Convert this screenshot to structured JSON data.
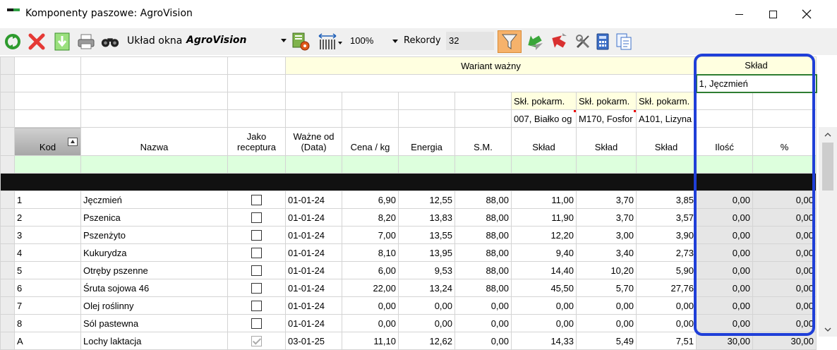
{
  "window": {
    "title": "Komponenty paszowe: AgroVision"
  },
  "toolbar": {
    "layout_label": "Układ okna",
    "layout_value": "AgroVision",
    "zoom_value": "100%",
    "records_label": "Rekordy",
    "records_value": "32",
    "icons": [
      "refresh-icon",
      "delete-icon",
      "download-icon",
      "print-icon",
      "search-binoculars-icon",
      "report-icon",
      "column-width-icon",
      "filter-icon",
      "transfer-green-icon",
      "transfer-red-icon",
      "tools-icon",
      "calculator-icon",
      "copy-icon"
    ]
  },
  "headers": {
    "wariant": "Wariant ważny",
    "sklad_group": "Skład",
    "ingredient_selected": "1, Jęczmień",
    "sklpk_label": "Skł. pokarm.",
    "sklpk_values": [
      "007, Białko og",
      "M170, Fosfor",
      "A101, Lizyna"
    ],
    "columns": {
      "kod": "Kod",
      "nazwa": "Nazwa",
      "jako_receptura": "Jako receptura",
      "wazne_od": "Ważne od (Data)",
      "cena": "Cena / kg",
      "energia": "Energia",
      "sm": "S.M.",
      "sklad1": "Skład",
      "sklad2": "Skład",
      "sklad3": "Skład",
      "ilosc": "Ilość",
      "procent": "%"
    }
  },
  "rows": [
    {
      "kod": "1",
      "nazwa": "Jęczmień",
      "receptura": false,
      "data": "01-01-24",
      "cena": "6,90",
      "energia": "12,55",
      "sm": "88,00",
      "s1": "11,00",
      "s2": "3,70",
      "s3": "3,85",
      "ilosc": "0,00",
      "proc": "0,00"
    },
    {
      "kod": "2",
      "nazwa": "Pszenica",
      "receptura": false,
      "data": "01-01-24",
      "cena": "8,20",
      "energia": "13,83",
      "sm": "88,00",
      "s1": "11,90",
      "s2": "3,70",
      "s3": "3,57",
      "ilosc": "0,00",
      "proc": "0,00"
    },
    {
      "kod": "3",
      "nazwa": "Pszenżyto",
      "receptura": false,
      "data": "01-01-24",
      "cena": "7,00",
      "energia": "13,55",
      "sm": "88,00",
      "s1": "12,20",
      "s2": "3,00",
      "s3": "3,90",
      "ilosc": "0,00",
      "proc": "0,00"
    },
    {
      "kod": "4",
      "nazwa": "Kukurydza",
      "receptura": false,
      "data": "01-01-24",
      "cena": "8,10",
      "energia": "13,95",
      "sm": "88,00",
      "s1": "9,40",
      "s2": "3,40",
      "s3": "2,73",
      "ilosc": "0,00",
      "proc": "0,00"
    },
    {
      "kod": "5",
      "nazwa": "Otręby pszenne",
      "receptura": false,
      "data": "01-01-24",
      "cena": "6,00",
      "energia": "9,53",
      "sm": "88,00",
      "s1": "14,40",
      "s2": "10,20",
      "s3": "5,90",
      "ilosc": "0,00",
      "proc": "0,00"
    },
    {
      "kod": "6",
      "nazwa": "Śruta sojowa 46",
      "receptura": false,
      "data": "01-01-24",
      "cena": "22,00",
      "energia": "13,24",
      "sm": "88,00",
      "s1": "45,50",
      "s2": "5,70",
      "s3": "27,76",
      "ilosc": "0,00",
      "proc": "0,00"
    },
    {
      "kod": "7",
      "nazwa": "Olej roślinny",
      "receptura": false,
      "data": "01-01-24",
      "cena": "0,00",
      "energia": "0,00",
      "sm": "0,00",
      "s1": "0,00",
      "s2": "0,00",
      "s3": "0,00",
      "ilosc": "0,00",
      "proc": "0,00"
    },
    {
      "kod": "8",
      "nazwa": "Sól pastewna",
      "receptura": false,
      "data": "01-01-24",
      "cena": "0,00",
      "energia": "0,00",
      "sm": "0,00",
      "s1": "0,00",
      "s2": "0,00",
      "s3": "0,00",
      "ilosc": "0,00",
      "proc": "0,00"
    },
    {
      "kod": "A",
      "nazwa": "Lochy laktacja",
      "receptura": true,
      "data": "03-01-25",
      "cena": "11,10",
      "energia": "12,62",
      "sm": "0,00",
      "s1": "14,33",
      "s2": "5,49",
      "s3": "7,51",
      "ilosc": "30,00",
      "proc": "30,00"
    }
  ],
  "colors": {
    "highlight_frame": "#1f3fd8",
    "header_yellow": "#ffffe0",
    "filter_row": "#ddffdd",
    "filter_button": "#f6b26b"
  }
}
